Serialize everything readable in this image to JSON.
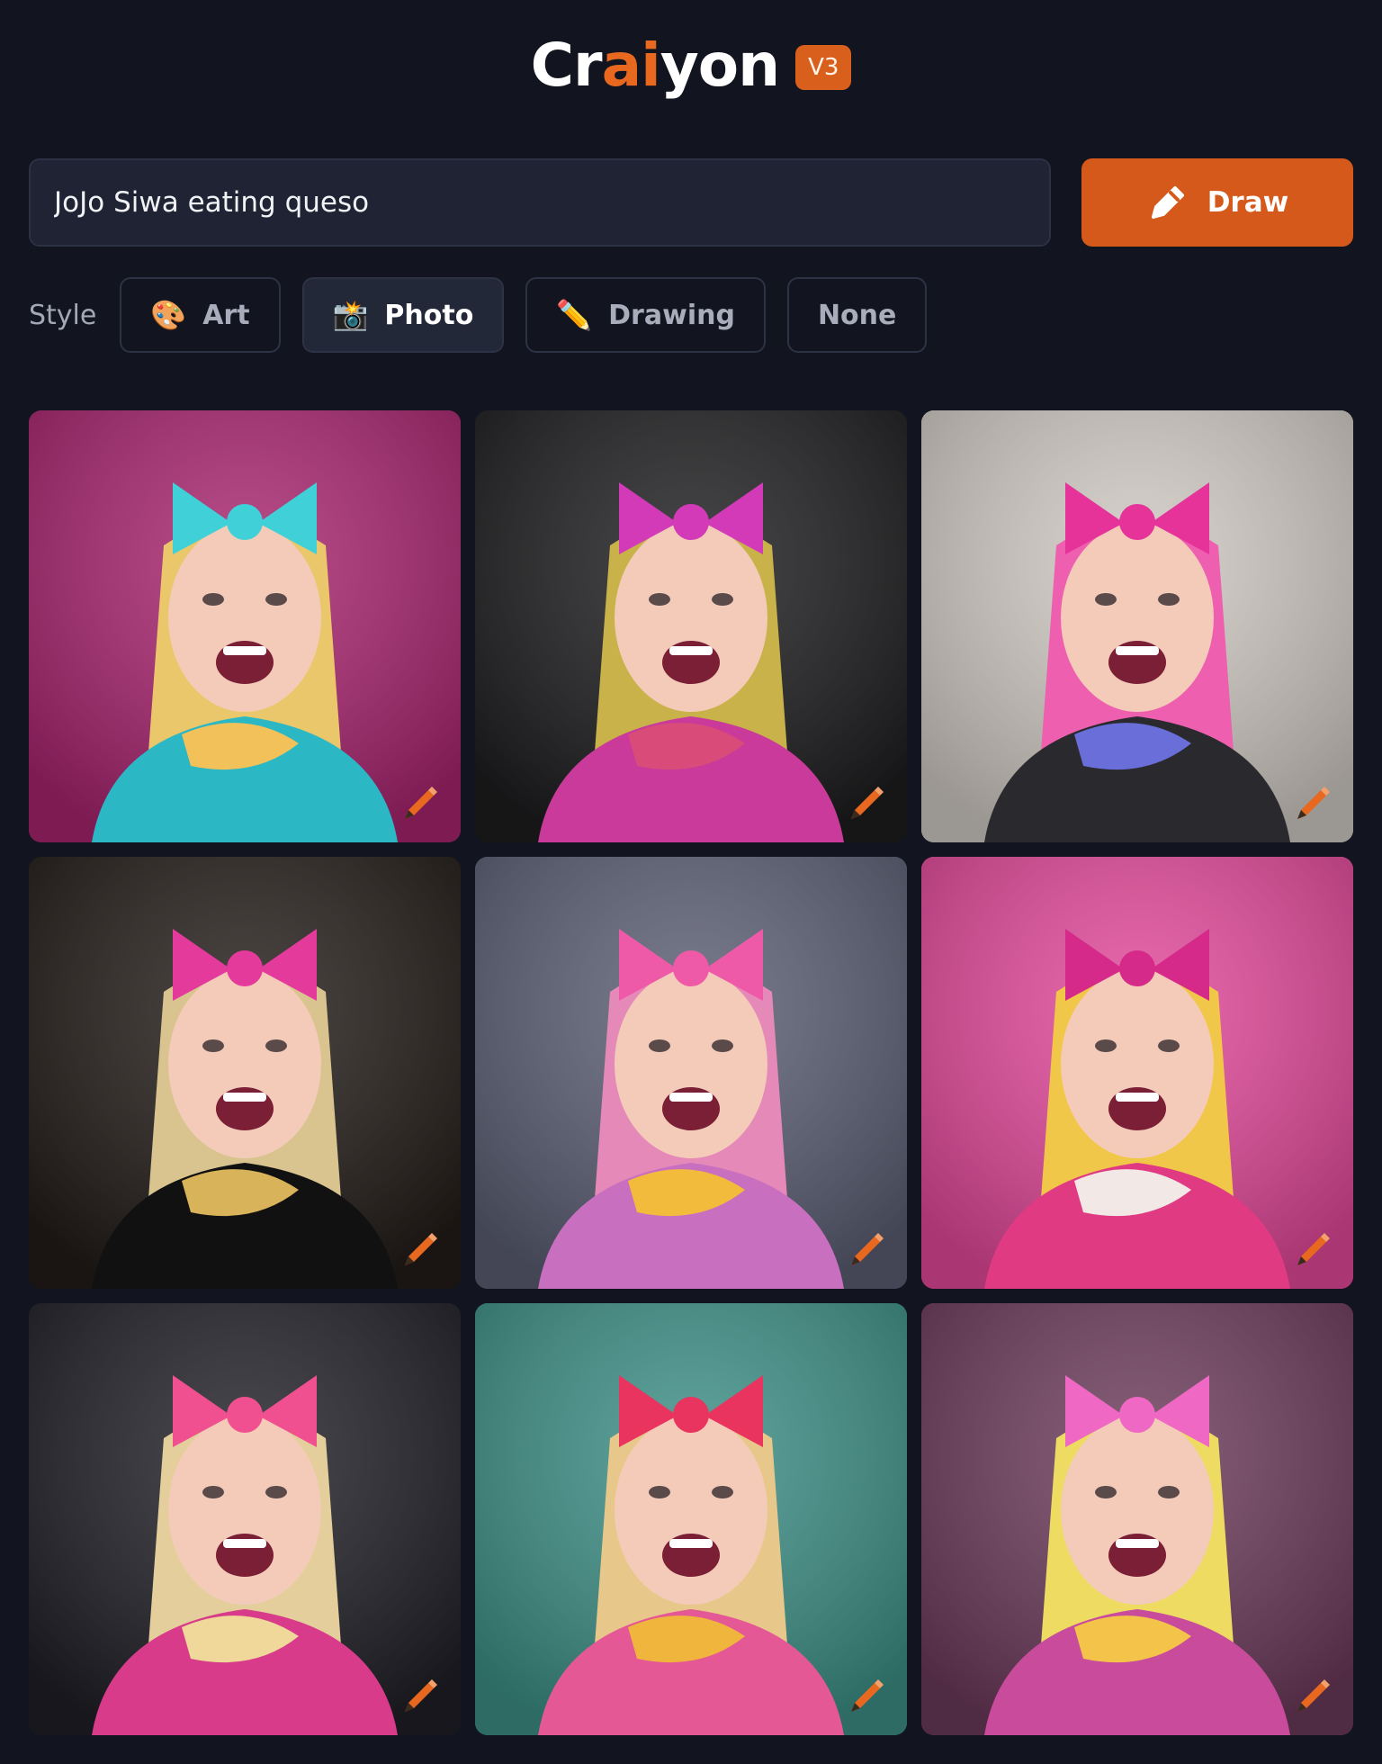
{
  "header": {
    "logo_part1": "Cr",
    "logo_accent": "ai",
    "logo_part2": "yon",
    "version": "V3"
  },
  "prompt": {
    "value": "JoJo Siwa eating queso",
    "draw_label": "Draw"
  },
  "style": {
    "label": "Style",
    "options": [
      {
        "label": "Art",
        "emoji": "🎨",
        "active": false
      },
      {
        "label": "Photo",
        "emoji": "📸",
        "active": true
      },
      {
        "label": "Drawing",
        "emoji": "✏️",
        "active": false
      },
      {
        "label": "None",
        "emoji": "",
        "active": false
      }
    ]
  },
  "results": [
    {
      "bg": "#a8246f",
      "bow": "#3fd0d8",
      "hair": "#e9c76a",
      "top": "#2bb7c4",
      "food": "#f2c15a"
    },
    {
      "bg": "#1d1d1f",
      "bow": "#d23ab8",
      "hair": "#c9b24a",
      "top": "#c93a9a",
      "food": "#d94c7a"
    },
    {
      "bg": "#cfc9c2",
      "bow": "#e6339a",
      "hair": "#ef5fb0",
      "top": "#2a2a2e",
      "food": "#6a6ed8"
    },
    {
      "bg": "#221c18",
      "bow": "#e43a9c",
      "hair": "#d9c490",
      "top": "#111111",
      "food": "#d8b35a"
    },
    {
      "bg": "#5b5e73",
      "bow": "#ef5aa8",
      "hair": "#e58ab8",
      "top": "#c86fbf",
      "food": "#f2bb3c"
    },
    {
      "bg": "#e2489a",
      "bow": "#d62a8a",
      "hair": "#f1c74a",
      "top": "#e03a82",
      "food": "#f2e9e6"
    },
    {
      "bg": "#1f1f26",
      "bow": "#f0508f",
      "hair": "#e4cf9c",
      "top": "#d83b8a",
      "food": "#f0d79a"
    },
    {
      "bg": "#3c8f86",
      "bow": "#e8345f",
      "hair": "#e8c88a",
      "top": "#e45995",
      "food": "#f0b53c"
    },
    {
      "bg": "#6b3a5a",
      "bow": "#ef68c3",
      "hair": "#eedb62",
      "top": "#c84b9c",
      "food": "#f4c44a"
    }
  ],
  "colors": {
    "accent": "#d4591a",
    "background": "#121520",
    "input_bg": "#1f2333"
  }
}
